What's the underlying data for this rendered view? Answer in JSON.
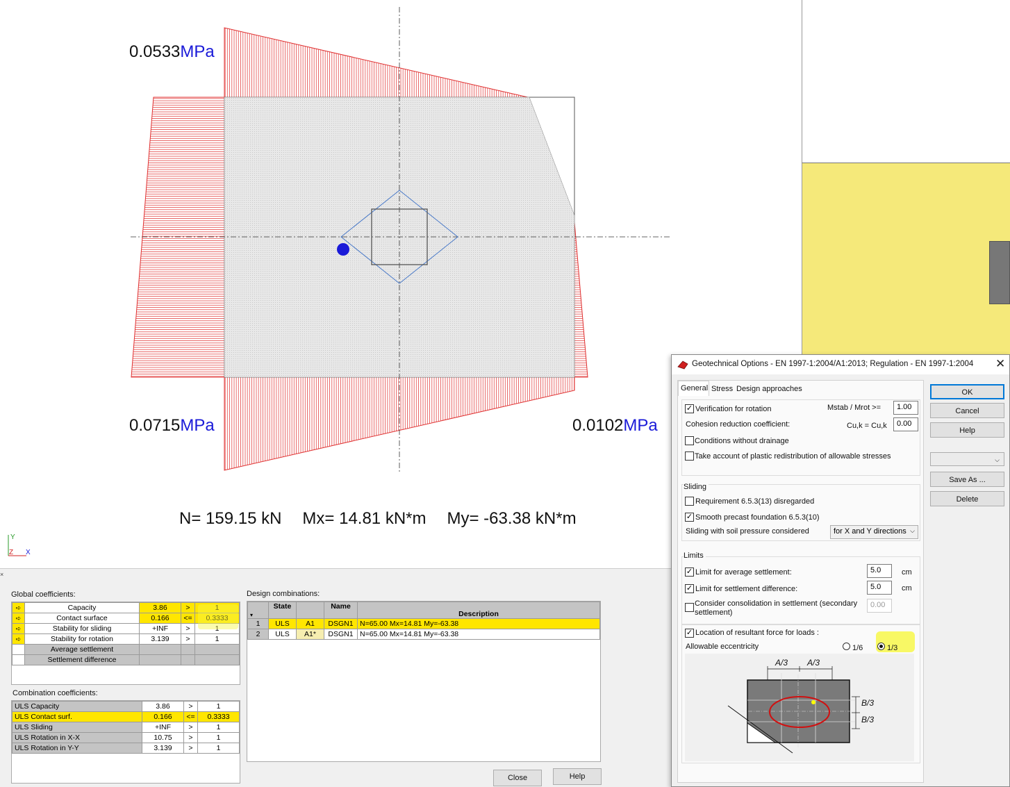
{
  "drawing": {
    "stress_top": {
      "value": "0.0533",
      "unit": "MPa"
    },
    "stress_bottom_left": {
      "value": "0.0715",
      "unit": "MPa"
    },
    "stress_bottom_right": {
      "value": "0.0102",
      "unit": "MPa"
    },
    "forces": {
      "n": "N= 159.15 kN",
      "mx": "Mx= 14.81 kN*m",
      "my": "My= -63.38 kN*m"
    },
    "axes": {
      "y": "Y",
      "z": "Z",
      "x": "X"
    },
    "colors": {
      "diagram": "#e03030",
      "resultant": "#1a1ad8",
      "side_panel": "#f5e97a"
    }
  },
  "results": {
    "global_title": "Global coefficients:",
    "global_rows": [
      {
        "label": "Capacity",
        "value": "3.86",
        "op": ">",
        "limit": "1",
        "highlight": true
      },
      {
        "label": "Contact surface",
        "value": "0.166",
        "op": "<=",
        "limit": "0.3333",
        "highlight": true
      },
      {
        "label": "Stability for sliding",
        "value": "+INF",
        "op": ">",
        "limit": "1",
        "highlight": false
      },
      {
        "label": "Stability for rotation",
        "value": "3.139",
        "op": ">",
        "limit": "1",
        "highlight": false
      },
      {
        "label": "Average settlement",
        "value": "",
        "op": "",
        "limit": "",
        "highlight": false
      },
      {
        "label": "Settlement difference",
        "value": "",
        "op": "",
        "limit": "",
        "highlight": false
      }
    ],
    "combination_title": "Combination coefficients:",
    "combination_rows": [
      {
        "label": "ULS Capacity",
        "value": "3.86",
        "op": ">",
        "limit": "1",
        "highlight": false
      },
      {
        "label": "ULS Contact surf.",
        "value": "0.166",
        "op": "<=",
        "limit": "0.3333",
        "highlight": true
      },
      {
        "label": "ULS Sliding",
        "value": "+INF",
        "op": ">",
        "limit": "1",
        "highlight": false
      },
      {
        "label": "ULS Rotation in X-X",
        "value": "10.75",
        "op": ">",
        "limit": "1",
        "highlight": false
      },
      {
        "label": "ULS Rotation in Y-Y",
        "value": "3.139",
        "op": ">",
        "limit": "1",
        "highlight": false
      }
    ],
    "design_title": "Design combinations:",
    "design_headers": [
      "State",
      "Name",
      "Description"
    ],
    "design_rows": [
      {
        "num": "1",
        "state": "ULS",
        "code": "A1",
        "name": "DSGN1",
        "desc": "N=65.00 Mx=14.81 My=-63.38"
      },
      {
        "num": "2",
        "state": "ULS",
        "code": "A1*",
        "name": "DSGN1",
        "desc": "N=65.00 Mx=14.81 My=-63.38"
      }
    ],
    "close_label": "Close",
    "help_label": "Help"
  },
  "dialog": {
    "title": "Geotechnical Options - EN 1997-1:2004/A1:2013;  Regulation - EN 1997-1:2004",
    "tabs": [
      "General",
      "Stress",
      "Design approaches"
    ],
    "verification_rotation": "Verification for rotation",
    "mstab_label": "Mstab / Mrot  >=",
    "mstab_value": "1.00",
    "cohesion_label": "Cohesion reduction coefficient:",
    "cu_label": "Cu,k = Cu,k",
    "cu_value": "0.00",
    "no_drainage": "Conditions without drainage",
    "plastic": "Take account of plastic redistribution of allowable stresses",
    "sliding_title": "Sliding",
    "req_disregarded": "Requirement 6.5.3(13) disregarded",
    "smooth_precast": "Smooth precast foundation 6.5.3(10)",
    "sliding_soil": "Sliding with soil pressure considered",
    "sliding_dir": "for X and Y directions",
    "limits_title": "Limits",
    "limit_avg": "Limit for average settlement:",
    "limit_avg_value": "5.0",
    "limit_diff": "Limit for settlement difference:",
    "limit_diff_value": "5.0",
    "unit_cm": "cm",
    "consolidation": "Consider consolidation in settlement (secondary settlement)",
    "consolidation_value": "0.00",
    "location_resultant": "Location of resultant force for loads :",
    "allowable_ecc": "Allowable eccentricity",
    "ecc_opt1": "1/6",
    "ecc_opt2": "1/3",
    "fig_a3": "A/3",
    "fig_b3": "B/3",
    "ok": "OK",
    "cancel": "Cancel",
    "help": "Help",
    "save_as": "Save As ...",
    "delete": "Delete"
  }
}
